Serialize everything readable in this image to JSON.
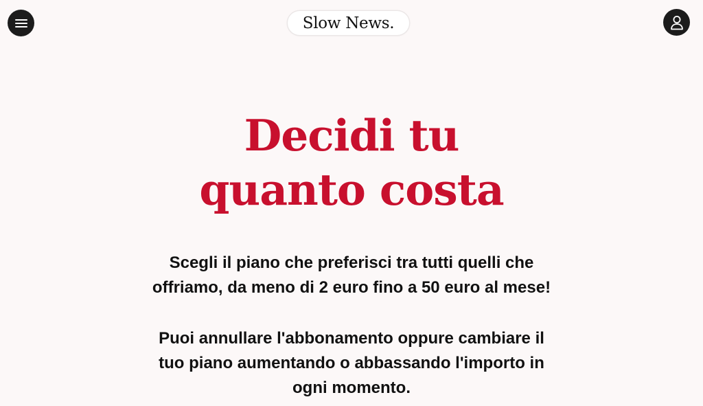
{
  "header": {
    "logo_text": "Slow News.",
    "menu_icon": "hamburger-menu-icon",
    "account_icon": "user-icon",
    "icon_button_color": "#1c1c1c"
  },
  "hero": {
    "title_lines": [
      "Decidi tu",
      "quanto costa"
    ],
    "title_color": "#c8102e",
    "paragraph_1_lines": [
      "Scegli il piano che preferisci tra tutti quelli che",
      "offriamo, da meno di 2 euro fino a 50 euro al mese!"
    ],
    "paragraph_2_lines": [
      "Puoi annullare l'abbonamento oppure cambiare il",
      "tuo piano aumentando o abbassando l'importo in",
      "ogni momento."
    ]
  },
  "colors": {
    "background": "#fcf8f8",
    "text": "#111111"
  }
}
